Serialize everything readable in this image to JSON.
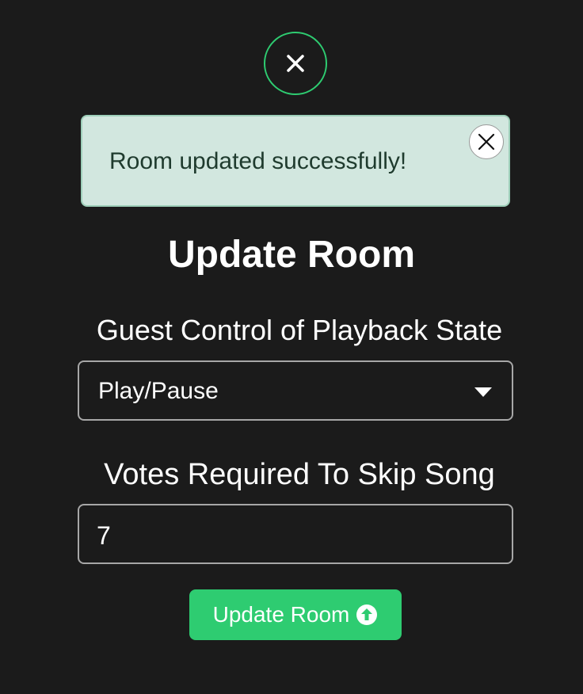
{
  "alert": {
    "message": "Room updated successfully!"
  },
  "form": {
    "title": "Update Room",
    "playback_label": "Guest Control of Playback State",
    "playback_value": "Play/Pause",
    "votes_label": "Votes Required To Skip Song",
    "votes_value": "7",
    "submit_label": "Update Room"
  },
  "icons": {
    "top_close": "close-icon",
    "alert_close": "close-icon",
    "select_caret": "caret-down-icon",
    "submit": "upload-arrow-circle-icon"
  },
  "colors": {
    "background": "#1b1b1b",
    "accent": "#2ecc71",
    "alert_bg": "#d2e7df",
    "alert_text": "#1f3b2e"
  }
}
